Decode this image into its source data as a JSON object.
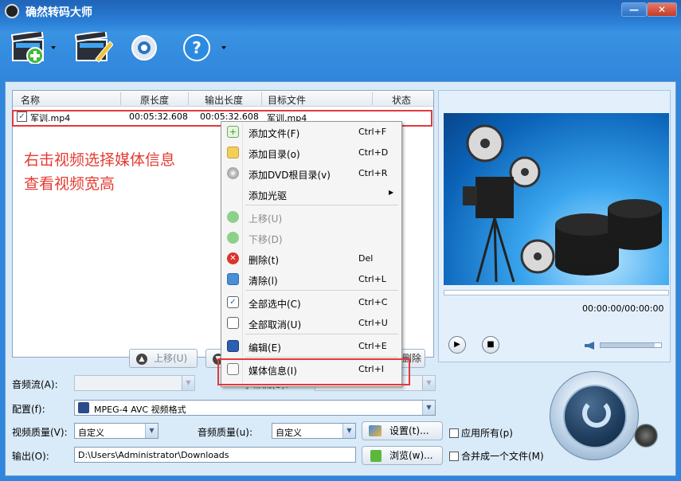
{
  "title": "确然转码大师",
  "window_buttons": {
    "minimize": "—",
    "close": "✕"
  },
  "toolbar": [
    {
      "name": "add-video-button",
      "icon": "clapper-add-icon"
    },
    {
      "name": "edit-video-button",
      "icon": "clapper-edit-icon"
    },
    {
      "name": "settings-button",
      "icon": "gear-icon"
    },
    {
      "name": "help-button",
      "icon": "help-icon"
    }
  ],
  "list": {
    "columns": [
      "名称",
      "原长度",
      "输出长度",
      "目标文件",
      "状态"
    ],
    "rows": [
      {
        "checked": true,
        "name": "军训.mp4",
        "original_length": "00:05:32.608",
        "output_length": "00:05:32.608",
        "target": "军训.mp4",
        "status": ""
      }
    ],
    "annotation_line1": "右击视频选择媒体信息",
    "annotation_line2": "查看视频宽高",
    "move_up_label": "上移(U)",
    "move_down_label": "下移(D)",
    "delete_label": "删除"
  },
  "preview": {
    "time": "00:00:00/00:00:00",
    "volume_fraction": 0.9
  },
  "form": {
    "audio_stream_label": "音频流(A):",
    "audio_stream_value": "",
    "subtitle_label": "字幕流(S):",
    "subtitle_value": "",
    "profile_label": "配置(f):",
    "profile_value": "MPEG-4 AVC 视频格式",
    "video_quality_label": "视频质量(V):",
    "video_quality_value": "自定义",
    "audio_quality_label": "音频质量(u):",
    "audio_quality_value": "自定义",
    "settings_label": "设置(t)...",
    "apply_all_label": "应用所有(p)",
    "output_label": "输出(O):",
    "output_value": "D:\\Users\\Administrator\\Downloads",
    "browse_label": "浏览(w)...",
    "merge_label": "合并成一个文件(M)"
  },
  "context_menu": {
    "items": [
      {
        "label": "添加文件(F)",
        "shortcut": "Ctrl+F",
        "icon": "add-file-icon",
        "disabled": false
      },
      {
        "label": "添加目录(o)",
        "shortcut": "Ctrl+D",
        "icon": "add-folder-icon",
        "disabled": false
      },
      {
        "label": "添加DVD根目录(v)",
        "shortcut": "Ctrl+R",
        "icon": "add-dvd-icon",
        "disabled": false
      },
      {
        "label": "添加光驱",
        "shortcut": "",
        "icon": "",
        "disabled": false
      },
      {
        "label": "上移(U)",
        "shortcut": "",
        "icon": "move-up-icon",
        "disabled": true
      },
      {
        "label": "下移(D)",
        "shortcut": "",
        "icon": "move-down-icon",
        "disabled": true
      },
      {
        "label": "删除(t)",
        "shortcut": "Del",
        "icon": "delete-icon",
        "disabled": false
      },
      {
        "label": "清除(l)",
        "shortcut": "Ctrl+L",
        "icon": "clear-icon",
        "disabled": false
      },
      {
        "label": "全部选中(C)",
        "shortcut": "Ctrl+C",
        "icon": "select-all-icon",
        "disabled": false
      },
      {
        "label": "全部取消(U)",
        "shortcut": "Ctrl+U",
        "icon": "unselect-all-icon",
        "disabled": false
      },
      {
        "label": "编辑(E)",
        "shortcut": "Ctrl+E",
        "icon": "edit-icon",
        "disabled": false
      },
      {
        "label": "媒体信息(I)",
        "shortcut": "Ctrl+I",
        "icon": "media-info-icon",
        "disabled": false
      }
    ]
  },
  "colors": {
    "accent_red": "#e3393c",
    "title_blue": "#1f64b8"
  }
}
